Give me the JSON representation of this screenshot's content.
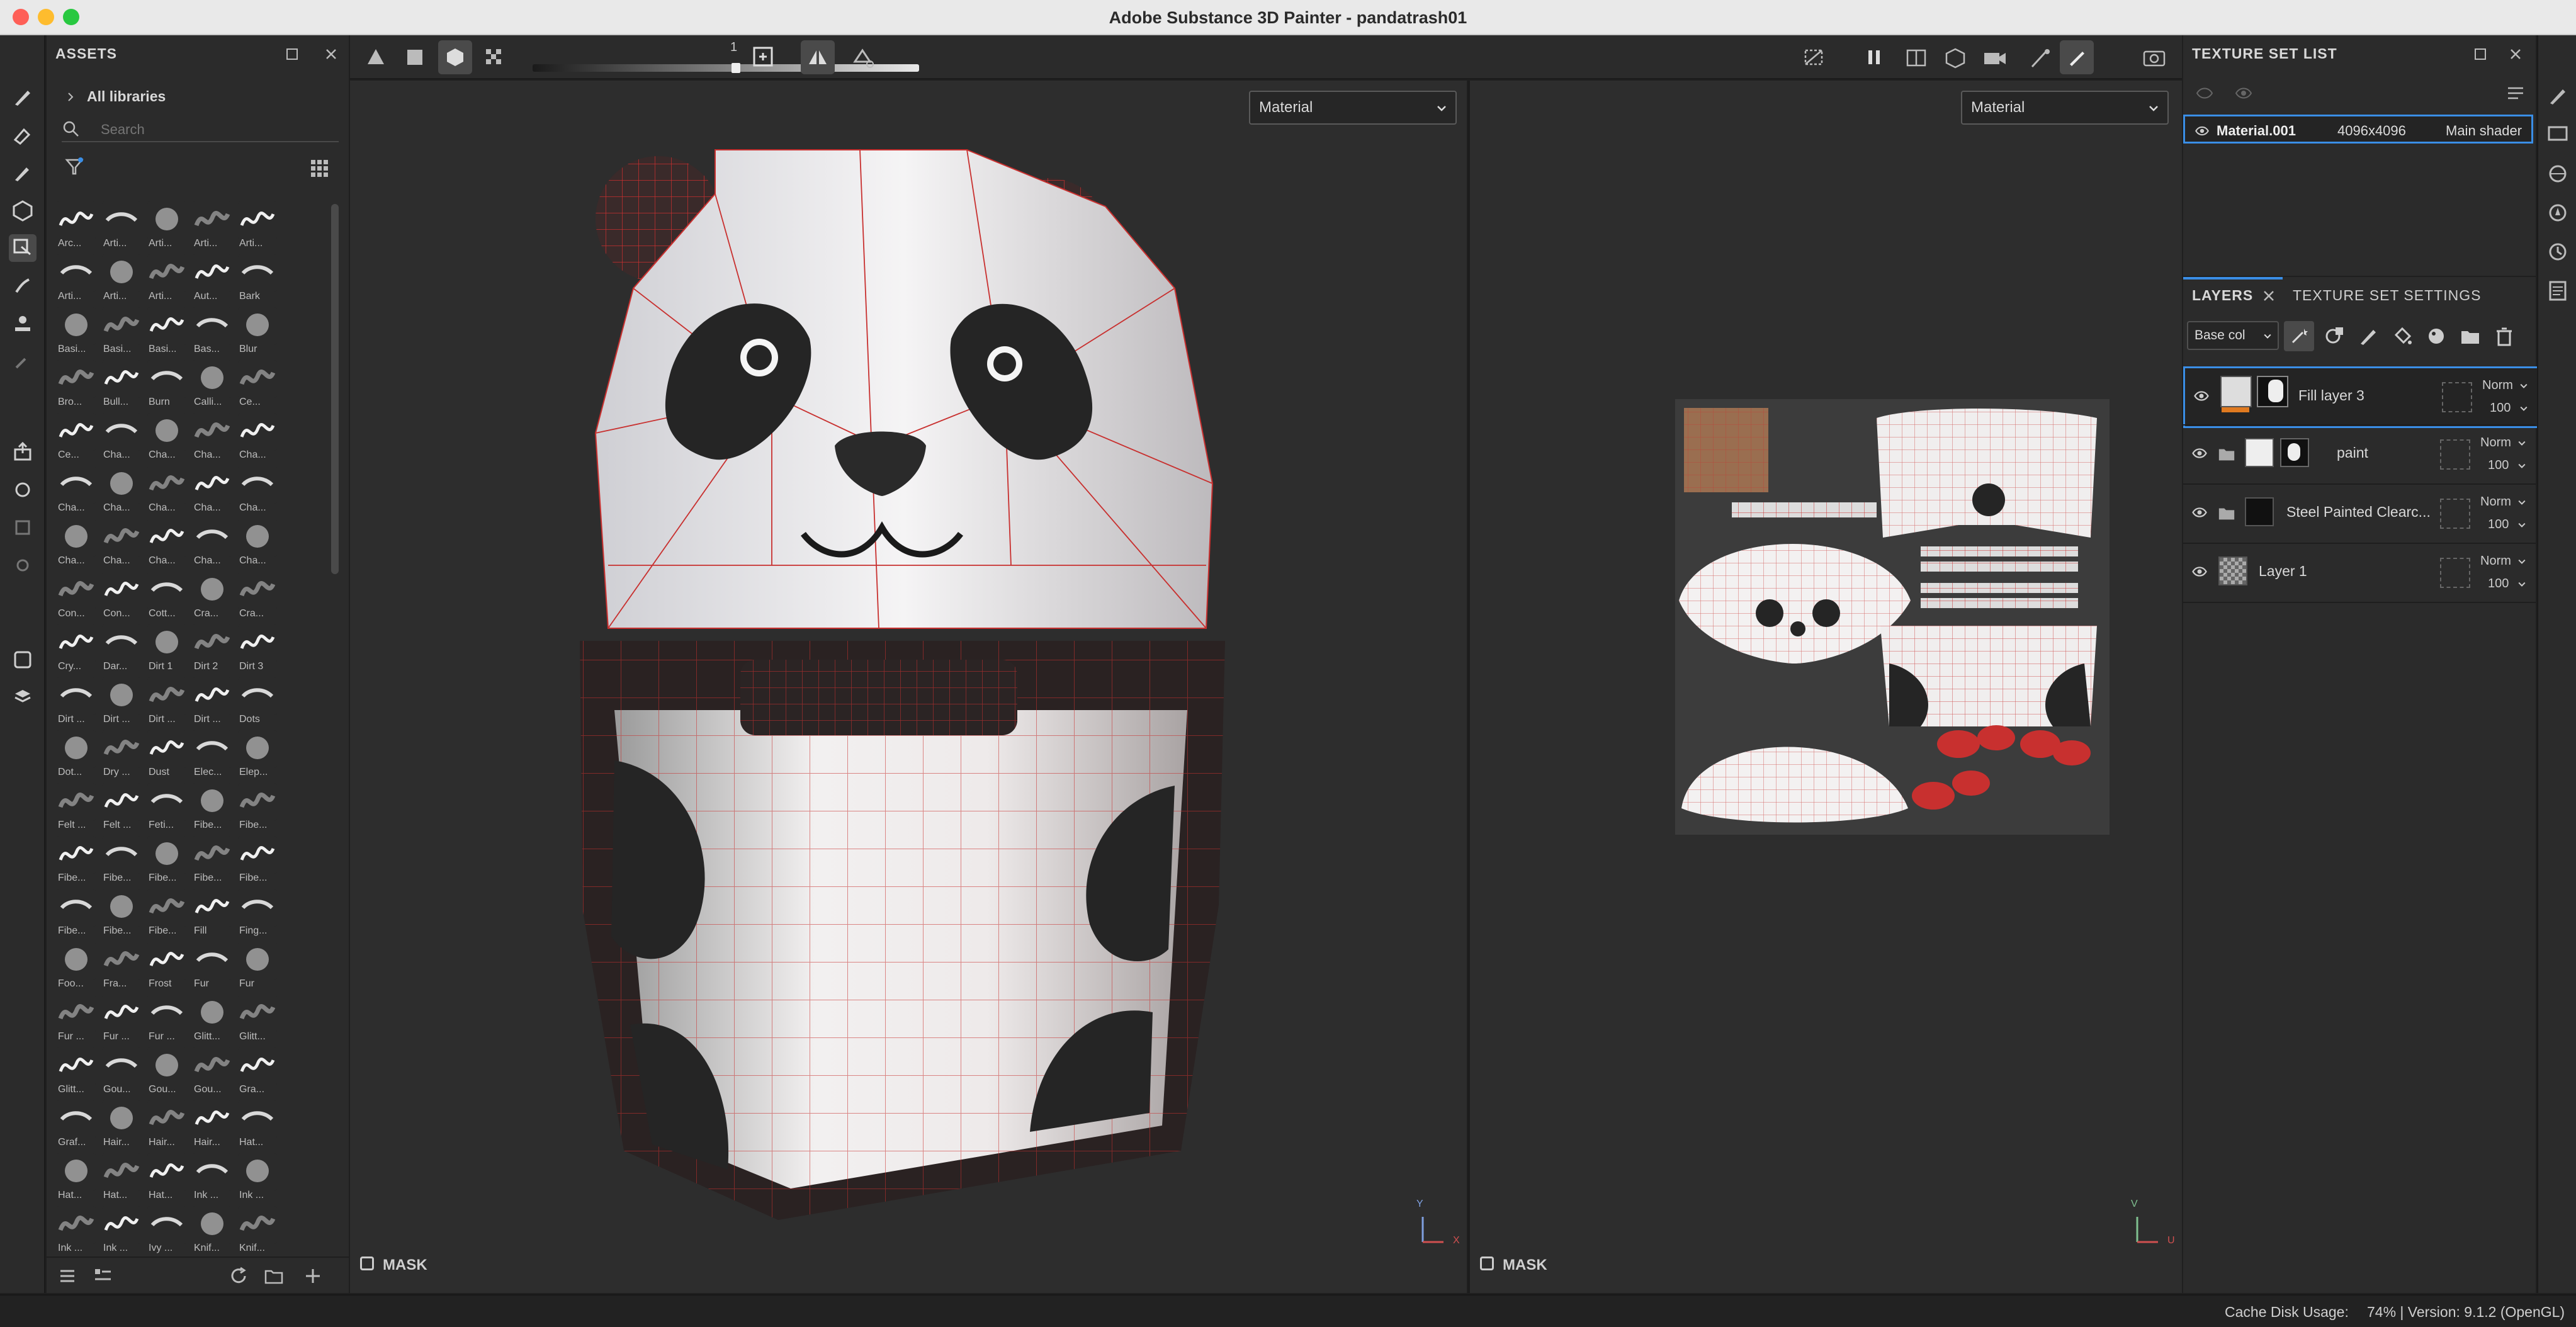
{
  "app": {
    "title": "Adobe Substance 3D Painter - pandatrash01"
  },
  "assets": {
    "header": "ASSETS",
    "breadcrumb": "All libraries",
    "search_placeholder": "Search",
    "items": [
      "Arc...",
      "Arti...",
      "Arti...",
      "Arti...",
      "Arti...",
      "Arti...",
      "Arti...",
      "Arti...",
      "Aut...",
      "Bark",
      "Basi...",
      "Basi...",
      "Basi...",
      "Bas...",
      "Blur",
      "Bro...",
      "Bull...",
      "Burn",
      "Calli...",
      "Ce...",
      "Ce...",
      "Cha...",
      "Cha...",
      "Cha...",
      "Cha...",
      "Cha...",
      "Cha...",
      "Cha...",
      "Cha...",
      "Cha...",
      "Cha...",
      "Cha...",
      "Cha...",
      "Cha...",
      "Cha...",
      "Con...",
      "Con...",
      "Cott...",
      "Cra...",
      "Cra...",
      "Cry...",
      "Dar...",
      "Dirt 1",
      "Dirt 2",
      "Dirt 3",
      "Dirt ...",
      "Dirt ...",
      "Dirt ...",
      "Dirt ...",
      "Dots",
      "Dot...",
      "Dry ...",
      "Dust",
      "Elec...",
      "Elep...",
      "Felt ...",
      "Felt ...",
      "Feti...",
      "Fibe...",
      "Fibe...",
      "Fibe...",
      "Fibe...",
      "Fibe...",
      "Fibe...",
      "Fibe...",
      "Fibe...",
      "Fibe...",
      "Fibe...",
      "Fill",
      "Fing...",
      "Foo...",
      "Fra...",
      "Frost",
      "Fur",
      "Fur",
      "Fur ...",
      "Fur ...",
      "Fur ...",
      "Glitt...",
      "Glitt...",
      "Glitt...",
      "Gou...",
      "Gou...",
      "Gou...",
      "Gra...",
      "Graf...",
      "Hair...",
      "Hair...",
      "Hair...",
      "Hat...",
      "Hat...",
      "Hat...",
      "Hat...",
      "Ink ...",
      "Ink ...",
      "Ink ...",
      "Ink ...",
      "Ivy ...",
      "Knif...",
      "Knif..."
    ]
  },
  "viewport": {
    "slider_value": "1",
    "left_mode": "Material",
    "right_mode": "Material",
    "mask_label_left": "MASK",
    "mask_label_right": "MASK",
    "axis_left": [
      "Y",
      "X"
    ],
    "axis_right": [
      "V",
      "U"
    ]
  },
  "texture_set_list": {
    "header": "TEXTURE SET LIST",
    "row": {
      "name": "Material.001",
      "resolution": "4096x4096",
      "shader": "Main shader"
    }
  },
  "layers": {
    "tab_layers": "LAYERS",
    "tab_settings": "TEXTURE SET SETTINGS",
    "channel": "Base col",
    "items": [
      {
        "name": "Fill layer 3",
        "blend": "Norm",
        "opacity": "100"
      },
      {
        "name": "paint",
        "blend": "Norm",
        "opacity": "100"
      },
      {
        "name": "Steel Painted Clearc...",
        "blend": "Norm",
        "opacity": "100"
      },
      {
        "name": "Layer 1",
        "blend": "Norm",
        "opacity": "100"
      }
    ]
  },
  "status": {
    "cache_label": "Cache Disk Usage:",
    "cache_value": "74% | Version: 9.1.2 (OpenGL)"
  },
  "colors": {
    "accent": "#3a8ee6",
    "mesh_red": "#c8302f",
    "panda_black": "#252525",
    "panda_white": "#f0eeee"
  }
}
